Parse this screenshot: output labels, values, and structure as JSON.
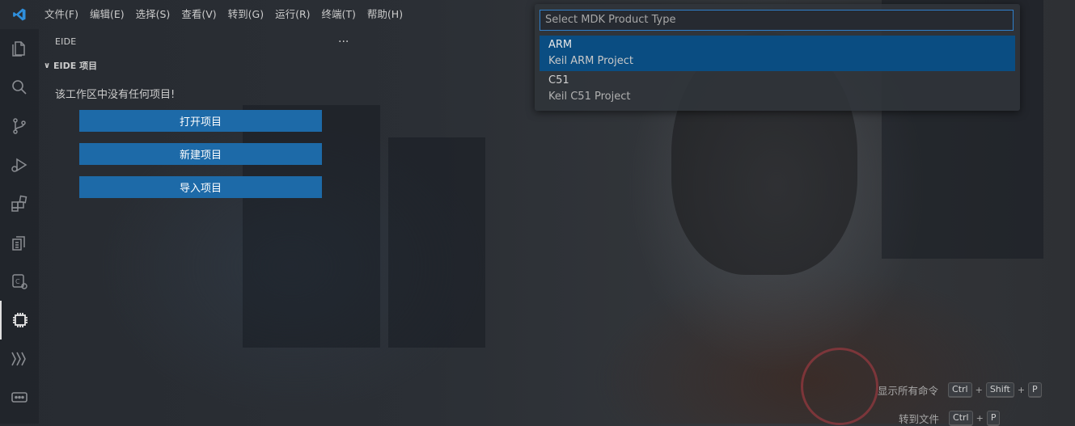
{
  "menu": [
    "文件(F)",
    "编辑(E)",
    "选择(S)",
    "查看(V)",
    "转到(G)",
    "运行(R)",
    "终端(T)",
    "帮助(H)"
  ],
  "activity_bar": [
    {
      "icon": "explorer-icon"
    },
    {
      "icon": "search-icon"
    },
    {
      "icon": "source-control-icon"
    },
    {
      "icon": "run-debug-icon"
    },
    {
      "icon": "extensions-icon"
    },
    {
      "icon": "remote-explorer-icon"
    },
    {
      "icon": "c-cpp-config-icon"
    },
    {
      "icon": "eide-chip-icon",
      "active": true
    },
    {
      "icon": "waveform-icon"
    },
    {
      "icon": "serial-monitor-icon"
    }
  ],
  "sidebar": {
    "header": "EIDE",
    "more": "...",
    "section_title": "EIDE 项目",
    "empty_message": "该工作区中没有任何项目!",
    "buttons": [
      "打开项目",
      "新建项目",
      "导入项目"
    ]
  },
  "quickpick": {
    "placeholder": "Select MDK Product Type",
    "items": [
      {
        "label": "ARM",
        "description": "Keil ARM Project",
        "selected": true
      },
      {
        "label": "C51",
        "description": "Keil C51 Project",
        "selected": false
      }
    ]
  },
  "hints": [
    {
      "label": "显示所有命令",
      "keys": [
        "Ctrl",
        "Shift",
        "P"
      ]
    },
    {
      "label": "转到文件",
      "keys": [
        "Ctrl",
        "P"
      ]
    }
  ],
  "colors": {
    "accent": "#007acc",
    "button_bg": "#1d6aa8",
    "selection_bg": "#0a4d82",
    "input_border": "#2f7fca"
  }
}
